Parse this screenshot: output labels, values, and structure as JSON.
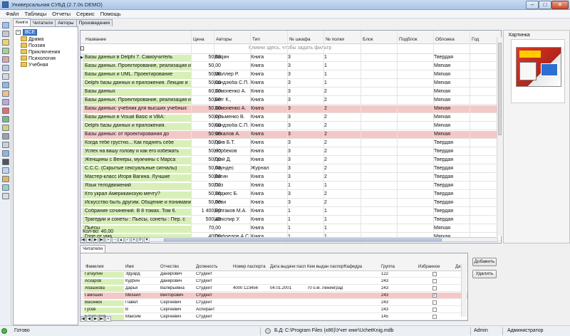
{
  "window": {
    "title": "Универсальная СУБД (2.7.0s DEMO)",
    "min": "–",
    "max": "□",
    "close": "✕"
  },
  "menu": [
    "Файл",
    "Таблицы",
    "Отчеты",
    "Сервис",
    "Помощь"
  ],
  "left_tabs": [
    "Книги",
    "Читатели",
    "Авторы",
    "Произведения"
  ],
  "tree": {
    "expander": "–",
    "root": "ВСЕ",
    "items": [
      "Драма",
      "Поэзия",
      "Приключения",
      "Психология",
      "Учебная"
    ]
  },
  "books": {
    "columns": [
      "Название",
      "Цена",
      "Авторы",
      "Тип",
      "№ шкафа",
      "№ полки",
      "Блок",
      "Подблок",
      "Обложка",
      "Год"
    ],
    "filter_hint": "Кликни здесь, чтобы задать фильтр",
    "current_row_marker": "▶",
    "rows": [
      {
        "name": "Базы данных в Delphi 7. Самоучитель",
        "price": "50,00",
        "author": "Ваqин",
        "type": "Книга",
        "shelf": "3",
        "num": "1",
        "cover": "Твердая",
        "hl": false
      },
      {
        "name": "Базы данных. Проектирование, реализация и",
        "price": "50,00",
        "author": "",
        "type": "Книга",
        "shelf": "3",
        "num": "1",
        "cover": "Мягкая",
        "hl": false
      },
      {
        "name": "Базы данных и UML. Проектирование",
        "price": "50,00",
        "author": "Мюллер Р.",
        "type": "Книга",
        "shelf": "3",
        "num": "1",
        "cover": "Мягкая",
        "hl": false
      },
      {
        "name": "Delphi базы данных и приложения. Лекции и",
        "price": "50,00",
        "author": "Кандзюба С.П.",
        "type": "Книга",
        "shelf": "3",
        "num": "1",
        "cover": "Мягкая",
        "hl": false
      },
      {
        "name": "Базы данных",
        "price": "60,00",
        "author": "Хомоненко А.",
        "type": "Книга",
        "shelf": "3",
        "num": "2",
        "cover": "Мягкая",
        "hl": false
      },
      {
        "name": "Базы данных. Проектирование, реализация и",
        "price": "50,00",
        "author": "Бегг К.,",
        "type": "Книга",
        "shelf": "3",
        "num": "2",
        "cover": "Мягкая",
        "hl": false
      },
      {
        "name": "Базы данных: учебник для высших учебных",
        "price": "50,00",
        "author": "Хомоненко А.",
        "type": "Книга",
        "shelf": "3",
        "num": "2",
        "cover": "Мягкая",
        "hl": true
      },
      {
        "name": "Базы данных в Visual Basic и VBA:",
        "price": "50,00",
        "author": "Кузьменко В.",
        "type": "Книга",
        "shelf": "3",
        "num": "2",
        "cover": "Мягкая",
        "hl": false
      },
      {
        "name": "Delphi базы данных и приложения.",
        "price": "50,00",
        "author": "Кандзюба С.П.",
        "type": "Книга",
        "shelf": "3",
        "num": "2",
        "cover": "Мягкая",
        "hl": false
      },
      {
        "name": "Базы данных: от проектирования до",
        "price": "50,00",
        "author": "Чекалов А.",
        "type": "Книга",
        "shelf": "3",
        "num": "2",
        "cover": "Мягкая",
        "hl": true
      },
      {
        "name": "Когда тебе грустно... Как поднять себе",
        "price": "50,00",
        "author": "Грив Б.Т.",
        "type": "Книга",
        "shelf": "3",
        "num": "2",
        "cover": "Твердая",
        "hl": false
      },
      {
        "name": "Успех на вашу голову и как его избежать",
        "price": "50,00",
        "author": "Норбеков",
        "type": "Книга",
        "shelf": "3",
        "num": "2",
        "cover": "Твердая",
        "hl": false
      },
      {
        "name": "Женщины с Венеры, мужчины с Марса",
        "price": "50,00",
        "author": "Грэй Д.",
        "type": "Книга",
        "shelf": "3",
        "num": "2",
        "cover": "Твердая",
        "hl": false
      },
      {
        "name": "С.С.С. (Скрытые сексуальные сигналы)",
        "price": "50,00",
        "author": "Лаундес",
        "type": "Журнал",
        "shelf": "3",
        "num": "2",
        "cover": "Твердая",
        "hl": false
      },
      {
        "name": "Мастер-класс Игоря Вагина. Лучшие",
        "price": "50,00",
        "author": "Вагин",
        "type": "Книга",
        "shelf": "3",
        "num": "2",
        "cover": "Твердая",
        "hl": false
      },
      {
        "name": "Язык телодвижений",
        "price": "50,00",
        "author": "Пиз",
        "type": "Книга",
        "shelf": "1",
        "num": "1",
        "cover": "Твердая",
        "hl": false
      },
      {
        "name": "Кто украл Американскую мечту?",
        "price": "50,00",
        "author": "Хеджес Б.",
        "type": "Книга",
        "shelf": "3",
        "num": "2",
        "cover": "Твердая",
        "hl": false
      },
      {
        "name": "Искусство быть другим. Общение и понимание",
        "price": "50,00",
        "author": "Леви",
        "type": "Книга",
        "shelf": "3",
        "num": "2",
        "cover": "Твердая",
        "hl": false
      },
      {
        "name": "Собрание сочинений. В 8 томах. Том 6.",
        "price": "1 400,00",
        "author": "Булгаков М.А.",
        "type": "Книга",
        "shelf": "1",
        "num": "1",
        "cover": "Твердая",
        "hl": false
      },
      {
        "name": "Трагедии и сонеты : Пьесы, сонеты : Пер. с",
        "price": "500,45",
        "author": "Шекспир У.",
        "type": "Книга",
        "shelf": "1",
        "num": "1",
        "cover": "Твердая",
        "hl": false
      },
      {
        "name": "Пьесы",
        "price": "70,00",
        "author": "",
        "type": "Книга",
        "shelf": "1",
        "num": "1",
        "cover": "Мягкая",
        "hl": false
      },
      {
        "name": "Горе от ума",
        "price": "40,00",
        "author": "Грибоедов А.С.",
        "type": "Книга",
        "shelf": "1",
        "num": "1",
        "cover": "Мягкая",
        "hl": false
      },
      {
        "name": "Пьесы",
        "price": "40,00",
        "author": "Островский",
        "type": "Книга",
        "shelf": "1",
        "num": "1",
        "cover": "Мягкая",
        "hl": false
      }
    ],
    "count_label": "Кол-во: 40,00"
  },
  "picture": {
    "label": "Картинка"
  },
  "nav_buttons": [
    "|◀",
    "◀",
    "▶",
    "▶|",
    "+",
    "–",
    "▲",
    "✓",
    "✕",
    "⟳",
    "▼"
  ],
  "readers_tab": "Читатели",
  "readers": {
    "columns": [
      "Фамилия",
      "Имя",
      "Отчество",
      "Должность",
      "Номер паспорта",
      "Дата выдачи пасп",
      "Кем выдан паспорт",
      "Кафедра",
      "Группа",
      "Избранное",
      "Да"
    ],
    "rows": [
      {
        "last": "Гатаулин",
        "first": "Эдуард",
        "middle": "Данирович",
        "pos": "Студент",
        "passport": "",
        "date": "",
        "issued": "",
        "dept": "",
        "group": "122",
        "fav": false,
        "hl": false
      },
      {
        "last": "Асхаров",
        "first": "Кудбин",
        "middle": "Данирович",
        "pos": "Студент",
        "passport": "",
        "date": "",
        "issued": "",
        "dept": "",
        "group": "243",
        "fav": false,
        "hl": false
      },
      {
        "last": "Абашкова",
        "first": "Дарья",
        "middle": "Валерьевна",
        "pos": "Студент",
        "passport": "4000 123456",
        "date": "04.01.2001",
        "issued": "70 о.м. Ленинграда",
        "dept": "",
        "group": "243",
        "fav": false,
        "hl": false
      },
      {
        "last": "Гамошин",
        "first": "Михаил",
        "middle": "Викторович",
        "pos": "Студент",
        "passport": "",
        "date": "",
        "issued": "",
        "dept": "",
        "group": "243",
        "fav": true,
        "hl": true
      },
      {
        "last": "Васинюк",
        "first": "Павел",
        "middle": "Сергеевич",
        "pos": "Студент",
        "passport": "",
        "date": "",
        "issued": "",
        "dept": "",
        "group": "243",
        "fav": false,
        "hl": false
      },
      {
        "last": "Гусев",
        "first": "В",
        "middle": "Сергеевич",
        "pos": "Аспирант",
        "passport": "",
        "date": "",
        "issued": "",
        "dept": "",
        "group": "243",
        "fav": false,
        "hl": false
      },
      {
        "last": "Богатырев",
        "first": "Максим",
        "middle": "Сергеевич",
        "pos": "Студент",
        "passport": "",
        "date": "",
        "issued": "",
        "dept": "",
        "group": "145",
        "fav": false,
        "hl": false
      }
    ],
    "check_mark": "✓",
    "add_button": "Добавить",
    "delete_button": "Удалить"
  },
  "status": {
    "ready": "Готово",
    "db_label": "Б.Д:",
    "db_path": "C:\\Program Files (x86)\\Учет книг\\UchetKnig.mdb",
    "user": "Admin",
    "role": "Администратор"
  }
}
